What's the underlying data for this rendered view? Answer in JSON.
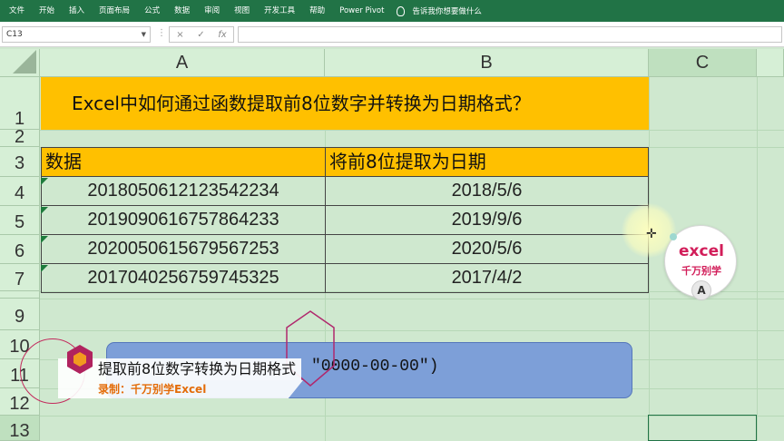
{
  "ribbon": {
    "tabs": [
      "文件",
      "开始",
      "插入",
      "页面布局",
      "公式",
      "数据",
      "审阅",
      "视图",
      "开发工具",
      "帮助",
      "Power Pivot"
    ],
    "tell_me": "告诉我你想要做什么",
    "bg_color": "#217346"
  },
  "formula_bar": {
    "name_box": "C13",
    "formula_icons": [
      "×",
      "✓",
      "fx"
    ],
    "value": ""
  },
  "columns": [
    "A",
    "B",
    "C"
  ],
  "rows": [
    "1",
    "2",
    "3",
    "4",
    "5",
    "6",
    "7",
    "9",
    "10",
    "11",
    "12",
    "13"
  ],
  "sheet": {
    "title": "Excel中如何通过函数提取前8位数字并转换为日期格式？",
    "headers": [
      "数据",
      "将前8位提取为日期"
    ],
    "data": [
      [
        "2018050612123542234",
        "2018/5/6"
      ],
      [
        "2019090616757864233",
        "2019/9/6"
      ],
      [
        "2020050615679567253",
        "2020/5/6"
      ],
      [
        "2017040256759745325",
        "2017/4/2"
      ]
    ],
    "highlight_color": "#ffc000"
  },
  "formula_box": {
    "text": "\"0000-00-00\")",
    "color": "#7d9fd8"
  },
  "caption": {
    "line1": "提取前8位数字转换为日期格式",
    "line2": "录制：千万别学Excel"
  },
  "logo": {
    "line1": "excel",
    "line2": "千万别学",
    "badge": "A"
  }
}
